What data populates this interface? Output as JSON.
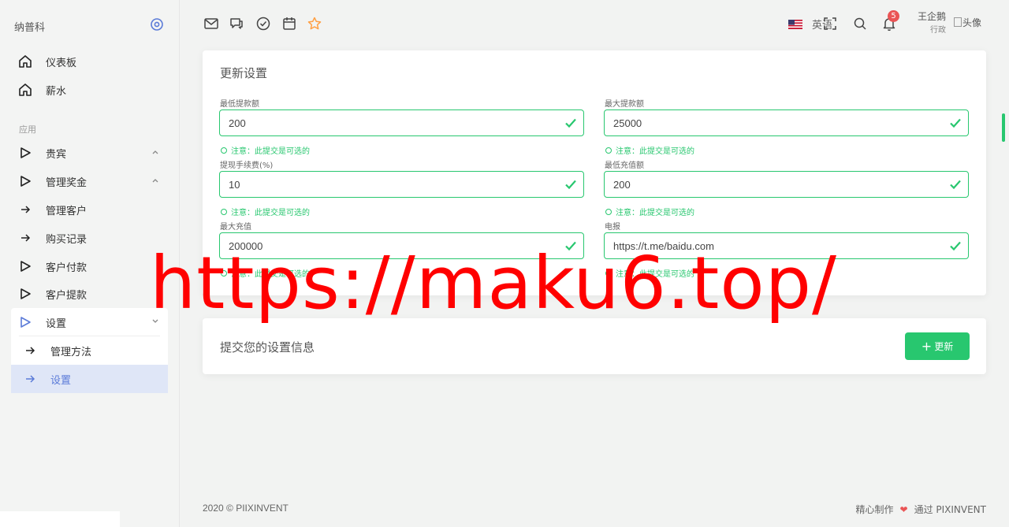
{
  "brand": "纳普科",
  "sidebar": {
    "items": [
      {
        "label": "仪表板"
      },
      {
        "label": "薪水"
      }
    ],
    "section_label": "应用",
    "app_items": [
      {
        "label": "贵宾"
      },
      {
        "label": "管理奖金"
      },
      {
        "label": "管理客户"
      },
      {
        "label": "购买记录"
      },
      {
        "label": "客户付款"
      },
      {
        "label": "客户提款"
      }
    ],
    "settings": {
      "label": "设置",
      "children": [
        {
          "label": "管理方法"
        },
        {
          "label": "设置"
        }
      ]
    }
  },
  "topbar": {
    "language": "英语",
    "notification_count": "5",
    "user_name": "王企鹅",
    "user_role": "行政",
    "avatar_alt": "头像"
  },
  "settings_card": {
    "title": "更新设置",
    "fields": [
      {
        "label": "最低提款额",
        "value": "200",
        "hint": "注意：此提交是可选的"
      },
      {
        "label": "最大提款额",
        "value": "25000",
        "hint": "注意：此提交是可选的"
      },
      {
        "label": "提现手续费(%)",
        "value": "10",
        "hint": "注意：此提交是可选的"
      },
      {
        "label": "最低充值额",
        "value": "200",
        "hint": "注意：此提交是可选的"
      },
      {
        "label": "最大充值",
        "value": "200000",
        "hint": "注意：此提交是可选的"
      },
      {
        "label": "电报",
        "value": "https://t.me/baidu.com",
        "hint": "注意：此提交是可选的"
      }
    ]
  },
  "submit_card": {
    "title": "提交您的设置信息",
    "button_label": "更新"
  },
  "footer": {
    "copyright": "2020 © PIIXINVENT",
    "made_with": "精心制作",
    "by": "通过 PIXINVENT"
  },
  "watermark": "https://maku6.top/",
  "colors": {
    "accent_green": "#28c76f",
    "active_blue": "#5b7bd8",
    "badge_red": "#ea5455",
    "watermark_red": "#ff0000"
  }
}
